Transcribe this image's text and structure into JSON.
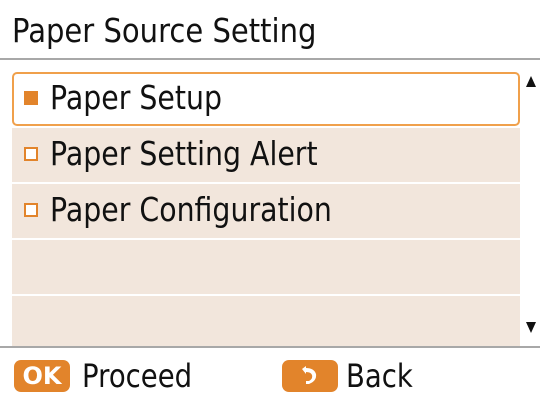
{
  "screen": {
    "title": "Paper Source Setting"
  },
  "menu": {
    "items": [
      {
        "label": "Paper Setup",
        "selected": true
      },
      {
        "label": "Paper Setting Alert",
        "selected": false
      },
      {
        "label": "Paper Configuration",
        "selected": false
      },
      {
        "label": "",
        "selected": false
      },
      {
        "label": "",
        "selected": false
      }
    ]
  },
  "footer": {
    "ok_key": "OK",
    "ok_label": "Proceed",
    "back_key_icon": "back-arrow-icon",
    "back_label": "Back"
  },
  "colors": {
    "accent": "#e2842b",
    "selection_border": "#f0a04b",
    "row_background": "#f2e6dc",
    "divider": "#a8a8a8"
  }
}
